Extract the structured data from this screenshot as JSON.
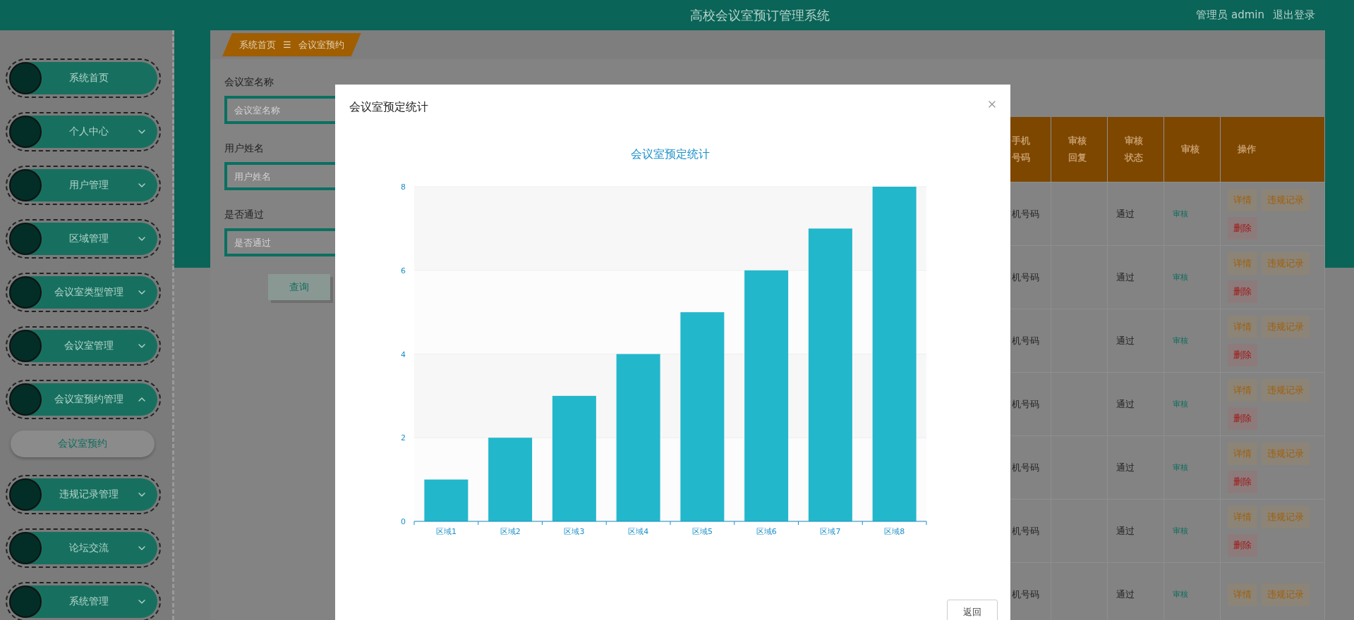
{
  "header": {
    "title": "高校会议室预订管理系统",
    "user": "管理员 admin",
    "logout": "退出登录"
  },
  "sidebar": {
    "items": [
      {
        "label": "系统首页"
      },
      {
        "label": "个人中心",
        "expanded": false
      },
      {
        "label": "用户管理",
        "expanded": false
      },
      {
        "label": "区域管理",
        "expanded": false
      },
      {
        "label": "会议室类型管理",
        "expanded": false
      },
      {
        "label": "会议室管理",
        "expanded": false
      },
      {
        "label": "会议室预约管理",
        "expanded": true,
        "children": [
          {
            "label": "会议室预约",
            "selected": true
          }
        ]
      },
      {
        "label": "违规记录管理",
        "expanded": false
      },
      {
        "label": "论坛交流",
        "expanded": false
      },
      {
        "label": "系统管理",
        "expanded": false
      }
    ]
  },
  "breadcrumb": {
    "home": "系统首页",
    "separator": "☰",
    "current": "会议室预约"
  },
  "search_form": {
    "fields": [
      {
        "label": "会议室名称",
        "placeholder": "会议室名称"
      },
      {
        "label": "用户姓名",
        "placeholder": "用户姓名"
      },
      {
        "label": "是否通过",
        "placeholder": "是否通过"
      }
    ],
    "button": "查询"
  },
  "table": {
    "columns": [
      "手机号码",
      "审核回复",
      "审核状态",
      "审核",
      "操作"
    ],
    "rows": [
      {
        "column_1": "机号码",
        "status": "通过",
        "review": "审核",
        "actions": [
          "详情",
          "违规记录",
          "删除"
        ]
      },
      {
        "column_1": "机号码",
        "status": "通过",
        "review": "审核",
        "actions": [
          "详情",
          "违规记录",
          "删除"
        ]
      },
      {
        "column_1": "机号码",
        "status": "通过",
        "review": "审核",
        "actions": [
          "详情",
          "违规记录",
          "删除"
        ]
      },
      {
        "column_1": "机号码",
        "status": "通过",
        "review": "审核",
        "actions": [
          "详情",
          "违规记录",
          "删除"
        ]
      },
      {
        "column_1": "机号码",
        "status": "通过",
        "review": "审核",
        "actions": [
          "详情",
          "违规记录",
          "删除"
        ]
      },
      {
        "column_1": "机号码",
        "status": "通过",
        "review": "审核",
        "actions": [
          "详情",
          "违规记录",
          "删除"
        ]
      },
      {
        "column_1": "机号码",
        "status": "通过",
        "review": "审核",
        "actions": [
          "详情",
          "违规记录"
        ]
      }
    ]
  },
  "modal": {
    "title": "会议室预定统计",
    "button": "返回",
    "chart_data": {
      "type": "bar",
      "title": "会议室预定统计",
      "categories": [
        "区域1",
        "区域2",
        "区域3",
        "区域4",
        "区域5",
        "区域6",
        "区域7",
        "区域8"
      ],
      "series": [
        {
          "color": "#23b7cb",
          "values": [
            1,
            2,
            3,
            4,
            5,
            6,
            7,
            8
          ]
        }
      ],
      "grid": true,
      "ylim": [
        0,
        8
      ],
      "yticks": [
        0,
        2,
        4,
        6,
        8
      ]
    }
  }
}
